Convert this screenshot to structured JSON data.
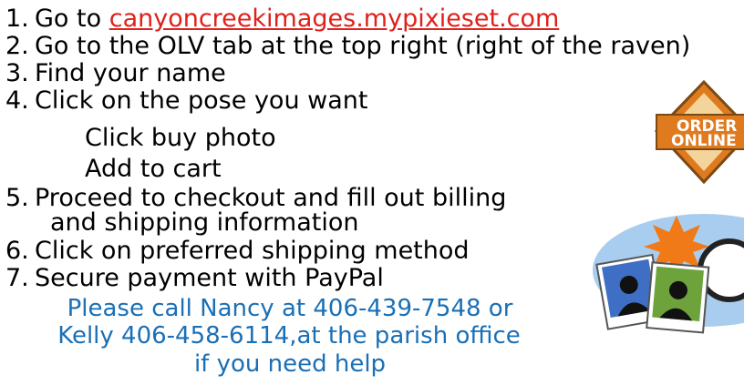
{
  "steps": [
    {
      "num": "1.",
      "text": "Go to ",
      "link": "canyoncreekimages.mypixieset.com"
    },
    {
      "num": "2.",
      "text": "Go to the OLV tab at the top right (right of the raven)"
    },
    {
      "num": "3.",
      "text": "Find your name"
    },
    {
      "num": "4.",
      "text": "Click on the pose you want",
      "sub": [
        "Click buy photo",
        "Add to cart"
      ]
    },
    {
      "num": "5.",
      "text": "Proceed to checkout and fill out billing",
      "cont": "and shipping information"
    },
    {
      "num": "6.",
      "text": "Click on preferred shipping method"
    },
    {
      "num": "7.",
      "text": "Secure payment with PayPal"
    }
  ],
  "help": [
    "Please call Nancy at 406-439-7548 or",
    "Kelly 406-458-6114,at the parish office",
    "if you need help"
  ],
  "badge": {
    "line1": "ORDER",
    "line2": "ONLINE",
    "icon": "order-online-badge"
  },
  "colors": {
    "link": "#e0201b",
    "help": "#1a6fb5",
    "badge_orange": "#e07a1f",
    "oval": "#a9cdee"
  },
  "icons": [
    "order-online-badge-icon",
    "camera-photos-icon"
  ]
}
